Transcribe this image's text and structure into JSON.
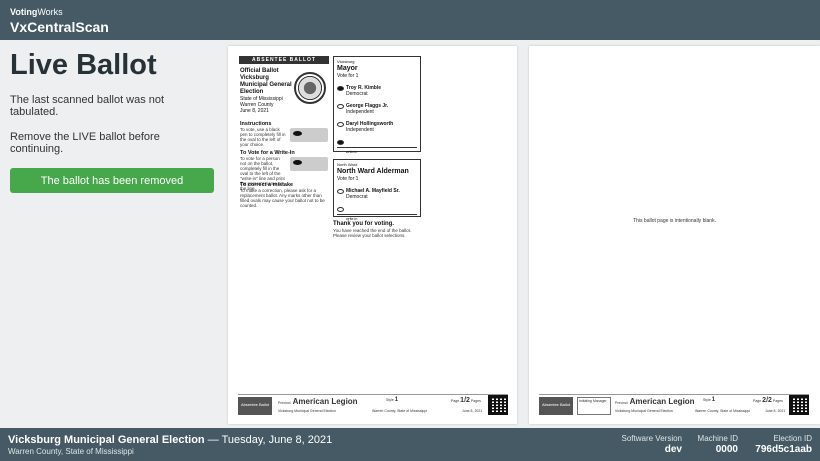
{
  "topbar": {
    "brand_bold": "Voting",
    "brand_light": "Works",
    "app_title": "VxCentralScan"
  },
  "main": {
    "heading": "Live Ballot",
    "message_1": "The last scanned ballot was not tabulated.",
    "message_2": "Remove the LIVE ballot before continuing.",
    "confirm_button": "The ballot has been removed"
  },
  "ballot_front": {
    "banner": "ABSENTEE BALLOT",
    "header_title": "Official Ballot",
    "header_city": "Vicksburg",
    "header_election": "Municipal General Election",
    "header_state": "State of Mississippi",
    "header_county": "Warren County",
    "header_date": "June 8, 2021",
    "instructions_title": "Instructions",
    "instructions_text": "To vote, use a black pen to completely fill in the oval to the left of your choice.",
    "writein_title": "To Vote for a Write-In",
    "writein_text": "To vote for a person not on the ballot, completely fill in the oval to the left of the \"write-in\" line and print the person's name on the line.",
    "correct_title": "To correct a mistake",
    "correct_text": "To make a correction, please ask for a replacement ballot. Any marks other than filled ovals may cause your ballot not to be counted.",
    "contests": [
      {
        "district": "Vicksburg",
        "title": "Mayor",
        "vote_for": "Vote for 1",
        "candidates": [
          {
            "name": "Troy R. Kimble",
            "party": "Democrat",
            "filled": true
          },
          {
            "name": "George Flaggs Jr.",
            "party": "Independent",
            "filled": false
          },
          {
            "name": "Daryl Hollingsworth",
            "party": "Independent",
            "filled": false
          }
        ],
        "write_in_label": "write-in"
      },
      {
        "district": "North Ward",
        "title": "North Ward Alderman",
        "vote_for": "Vote for 1",
        "candidates": [
          {
            "name": "Michael A. Mayfield Sr.",
            "party": "Democrat",
            "filled": false
          }
        ],
        "write_in_label": "write-in"
      }
    ],
    "thanks_title": "Thank you for voting.",
    "thanks_text": "You have reached the end of the ballot. Please review your ballot selections.",
    "footer": {
      "badge": "Absentee Ballot",
      "precinct_label": "Precinct",
      "precinct": "American Legion",
      "style_label": "Style",
      "style": "1",
      "page_label": "Page",
      "page": "1/2",
      "pages_label": "Pages",
      "election": "Vicksburg Municipal General Election",
      "county_state": "Warren County, State of Mississippi",
      "date": "June 8, 2021"
    }
  },
  "ballot_back": {
    "blank_message": "This ballot page is intentionally blank.",
    "footer": {
      "badge": "Absentee Ballot",
      "signature_label": "Initialing Manager",
      "precinct_label": "Precinct",
      "precinct": "American Legion",
      "style_label": "Style",
      "style": "1",
      "page_label": "Page",
      "page": "2/2",
      "pages_label": "Pages",
      "election": "Vicksburg Municipal General Election",
      "county_state": "Warren County, State of Mississippi",
      "date": "June 8, 2021"
    }
  },
  "bottombar": {
    "election_title": "Vicksburg Municipal General Election",
    "election_date": "Tuesday, June 8, 2021",
    "election_location": "Warren County, State of Mississippi",
    "software_version_label": "Software Version",
    "software_version": "dev",
    "machine_id_label": "Machine ID",
    "machine_id": "0000",
    "election_id_label": "Election ID",
    "election_id": "796d5c1aab"
  },
  "colors": {
    "bar": "#455a64",
    "primary_button": "#47a74b",
    "background": "#edeff0"
  }
}
